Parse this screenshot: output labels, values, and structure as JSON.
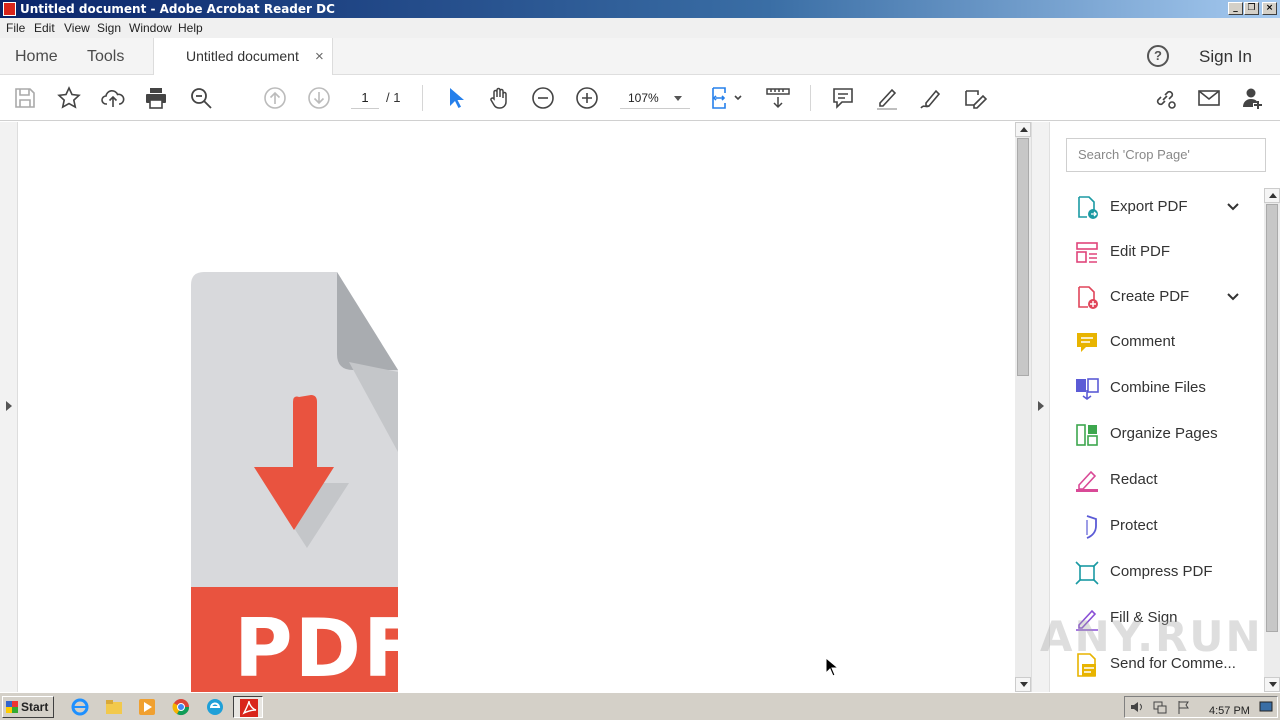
{
  "window": {
    "title": "Untitled document - Adobe Acrobat Reader DC",
    "controls": [
      "minimize",
      "restore",
      "close"
    ]
  },
  "menubar": [
    "File",
    "Edit",
    "View",
    "Sign",
    "Window",
    "Help"
  ],
  "nav": {
    "home": "Home",
    "tools": "Tools",
    "doc_tab": "Untitled document",
    "close_glyph": "×",
    "help_glyph": "?",
    "sign_in": "Sign In"
  },
  "toolbar": {
    "page_current": "1",
    "page_total": "/ 1",
    "zoom": "107%"
  },
  "document": {
    "pdf_icon_text": "PDF"
  },
  "right_panel": {
    "search_placeholder": "Search 'Crop Page'",
    "tools": [
      {
        "label": "Export PDF",
        "icon": "export-pdf-icon",
        "color": "#1b9aa3",
        "expandable": true
      },
      {
        "label": "Edit PDF",
        "icon": "edit-pdf-icon",
        "color": "#e0457b",
        "expandable": false
      },
      {
        "label": "Create PDF",
        "icon": "create-pdf-icon",
        "color": "#e0455a",
        "expandable": true
      },
      {
        "label": "Comment",
        "icon": "comment-icon",
        "color": "#e8b400",
        "expandable": false
      },
      {
        "label": "Combine Files",
        "icon": "combine-files-icon",
        "color": "#5b5bd6",
        "expandable": false
      },
      {
        "label": "Organize Pages",
        "icon": "organize-pages-icon",
        "color": "#3da74e",
        "expandable": false
      },
      {
        "label": "Redact",
        "icon": "redact-icon",
        "color": "#d94a97",
        "expandable": false
      },
      {
        "label": "Protect",
        "icon": "protect-icon",
        "color": "#5b5bd6",
        "expandable": false
      },
      {
        "label": "Compress PDF",
        "icon": "compress-pdf-icon",
        "color": "#1b9aa3",
        "expandable": false
      },
      {
        "label": "Fill & Sign",
        "icon": "fill-sign-icon",
        "color": "#8a4fd6",
        "expandable": false
      },
      {
        "label": "Send for Comme...",
        "icon": "send-for-comment-icon",
        "color": "#e8b400",
        "expandable": false
      }
    ]
  },
  "watermark": "ANY.RUN",
  "taskbar": {
    "start": "Start",
    "clock": "4:57 PM"
  }
}
